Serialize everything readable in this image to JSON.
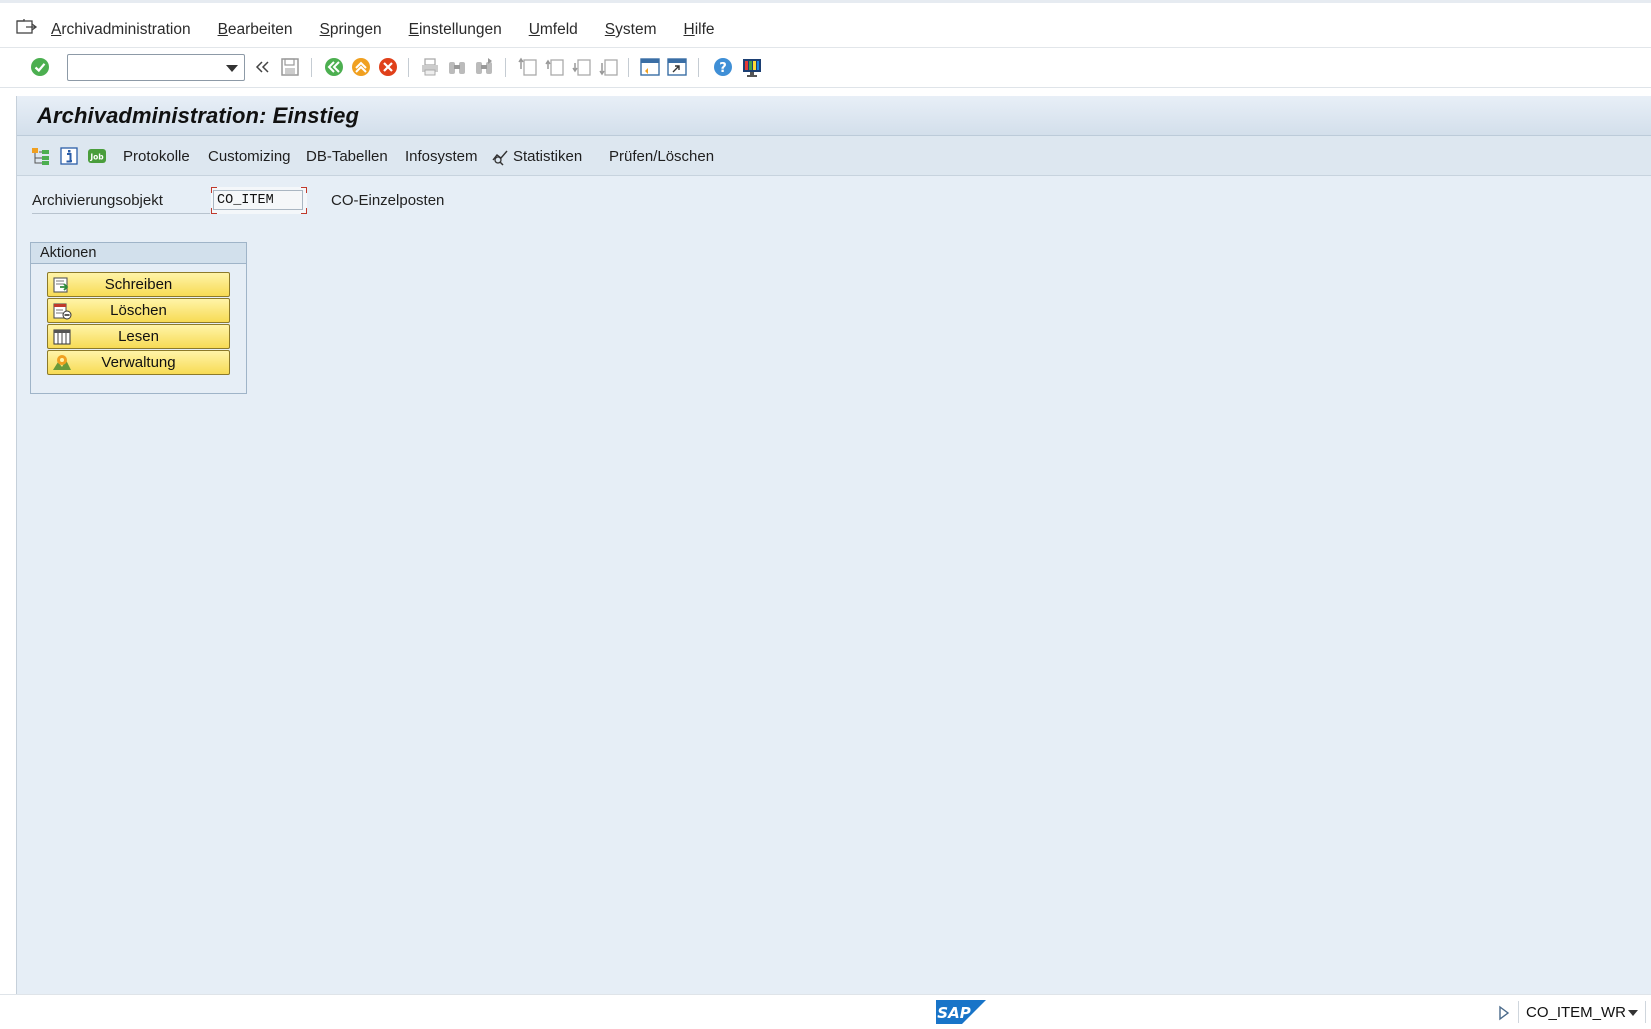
{
  "menu": {
    "items": [
      {
        "label": "Archivadministration",
        "icon": "none"
      },
      {
        "label": "Bearbeiten"
      },
      {
        "label": "Springen"
      },
      {
        "label": "Einstellungen"
      },
      {
        "label": "Umfeld"
      },
      {
        "label": "System"
      },
      {
        "label": "Hilfe"
      }
    ]
  },
  "toolbar": {
    "command_field_value": "",
    "icons": [
      "enter-icon",
      "command-dropdown-icon",
      "collapse-icon",
      "save-icon",
      "back-icon",
      "exit-icon",
      "cancel-icon",
      "print-icon",
      "find-icon",
      "find-next-icon",
      "first-page-icon",
      "previous-page-icon",
      "next-page-icon",
      "last-page-icon",
      "new-session-icon",
      "shortcut-icon",
      "help-icon",
      "customize-layout-icon"
    ]
  },
  "window": {
    "title": "Archivadministration: Einstieg"
  },
  "app_toolbar": {
    "icons": [
      "hierarchy-icon",
      "info-icon",
      "job-icon"
    ],
    "job_label": "Job",
    "protokolle": "Protokolle",
    "customizing": "Customizing",
    "db_tabellen": "DB-Tabellen",
    "infosystem": "Infosystem",
    "statistiken": "Statistiken",
    "pruefen_loeschen": "Prüfen/Löschen"
  },
  "form": {
    "archiving_object_label": "Archivierungsobjekt",
    "archiving_object_value": "CO_ITEM",
    "archiving_object_desc": "CO-Einzelposten"
  },
  "actions": {
    "title": "Aktionen",
    "write": "Schreiben",
    "delete": "Löschen",
    "read": "Lesen",
    "manage": "Verwaltung"
  },
  "status": {
    "logo": "SAP",
    "system": "CO_ITEM_WR"
  },
  "colors": {
    "frame_bg": "#e6eef6",
    "button_yellow": "#f7db55",
    "sap_blue": "#1874c8"
  }
}
